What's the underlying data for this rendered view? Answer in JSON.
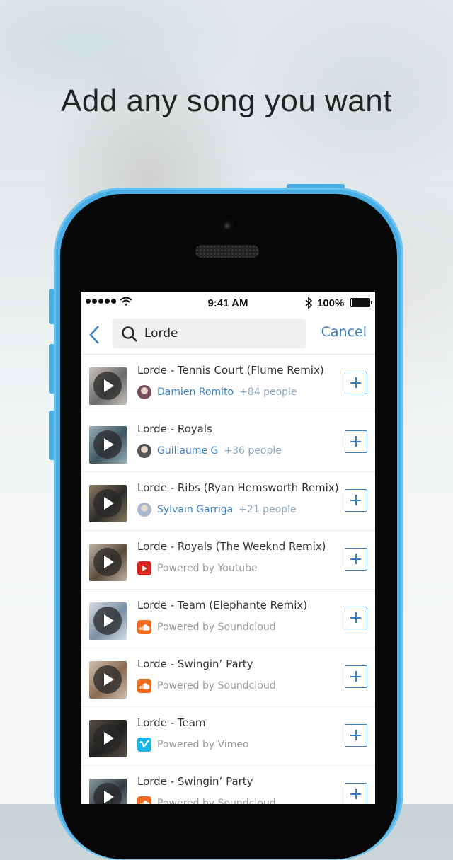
{
  "headline": "Add any song you want",
  "status": {
    "time": "9:41 AM",
    "battery": "100%"
  },
  "search": {
    "query": "Lorde",
    "cancel_label": "Cancel"
  },
  "results": [
    {
      "title": "Lorde - Tennis Court (Flume Remix)",
      "user": "Damien Romito",
      "count": "+84 people",
      "thumb": [
        "#6a6a6a",
        "#c9c3bb"
      ],
      "avatar": "#7a4e5e"
    },
    {
      "title": "Lorde - Royals",
      "user": "Guillaume G",
      "count": "+36 people",
      "thumb": [
        "#3d5560",
        "#9bb0b8"
      ],
      "avatar": "#555555"
    },
    {
      "title": "Lorde - Ribs (Ryan Hemsworth Remix)",
      "user": "Sylvain Garriga",
      "count": "+21 people",
      "thumb": [
        "#2a2a2a",
        "#8a7a60"
      ],
      "avatar": "#a7b8cc"
    },
    {
      "title": "Lorde - Royals (The Weeknd Remix)",
      "source_icon": "youtube-icon",
      "source_color": "#d7261f",
      "powered": "Powered by Youtube",
      "thumb": [
        "#5a4a3a",
        "#c0b3a5"
      ]
    },
    {
      "title": "Lorde - Team (Elephante Remix)",
      "source_icon": "soundcloud-icon",
      "source_color": "#f26b1d",
      "powered": "Powered by Soundcloud",
      "thumb": [
        "#7a8fa5",
        "#d6dde3"
      ]
    },
    {
      "title": "Lorde - Swingin’ Party",
      "source_icon": "soundcloud-icon",
      "source_color": "#f26b1d",
      "powered": "Powered by Soundcloud",
      "thumb": [
        "#8a6a50",
        "#d0c0b0"
      ]
    },
    {
      "title": "Lorde - Team",
      "source_icon": "vimeo-icon",
      "source_color": "#1ab7ea",
      "powered": "Powered by Vimeo",
      "thumb": [
        "#1e1e1e",
        "#5a5045"
      ]
    },
    {
      "title": "Lorde - Swingin’ Party",
      "source_icon": "soundcloud-icon",
      "source_color": "#f26b1d",
      "powered": "Powered by Soundcloud",
      "thumb": [
        "#2f3a40",
        "#8a9aa0"
      ]
    }
  ],
  "colors": {
    "accent": "#3a7fc4",
    "phone_body": "#4aaee6"
  }
}
